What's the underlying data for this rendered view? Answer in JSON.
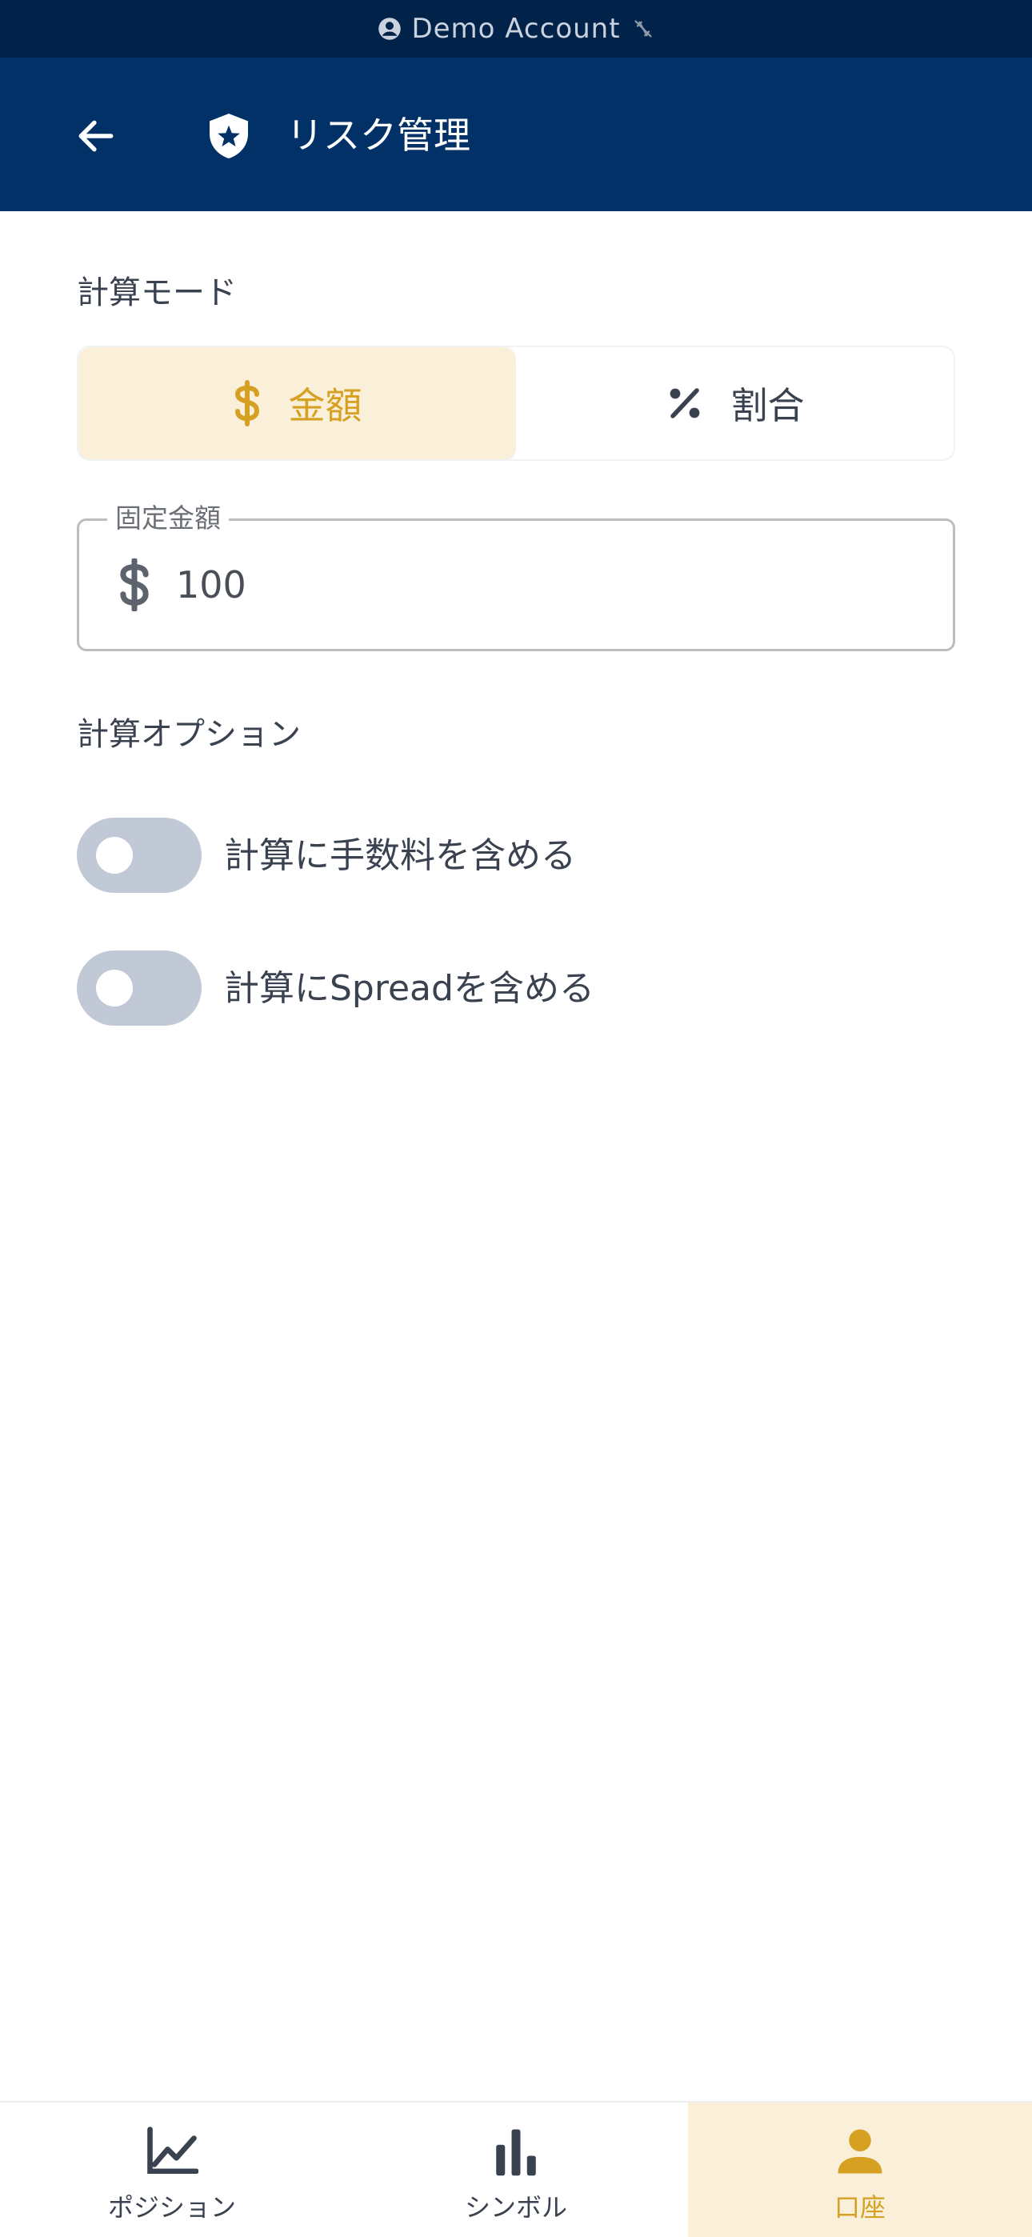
{
  "status_bar": {
    "account_label": "Demo Account"
  },
  "header": {
    "title": "リスク管理"
  },
  "calc_mode": {
    "section_label": "計算モード",
    "options": [
      {
        "label": "金額",
        "icon": "dollar-icon",
        "selected": true
      },
      {
        "label": "割合",
        "icon": "percent-icon",
        "selected": false
      }
    ]
  },
  "fixed_amount": {
    "label": "固定金額",
    "value": "100",
    "prefix_icon": "dollar-icon"
  },
  "calc_options": {
    "section_label": "計算オプション",
    "toggles": [
      {
        "label": "計算に手数料を含める",
        "on": false
      },
      {
        "label": "計算にSpreadを含める",
        "on": false
      }
    ]
  },
  "bottom_nav": {
    "items": [
      {
        "label": "ポジション",
        "icon": "line-chart-icon",
        "active": false
      },
      {
        "label": "シンボル",
        "icon": "bar-chart-icon",
        "active": false
      },
      {
        "label": "口座",
        "icon": "person-icon",
        "active": true
      }
    ]
  },
  "colors": {
    "status_bar_bg": "#012249",
    "app_bar_bg": "#023168",
    "accent": "#d6a023",
    "accent_bg": "#faf0da",
    "toggle_off": "#c1c9d6"
  }
}
